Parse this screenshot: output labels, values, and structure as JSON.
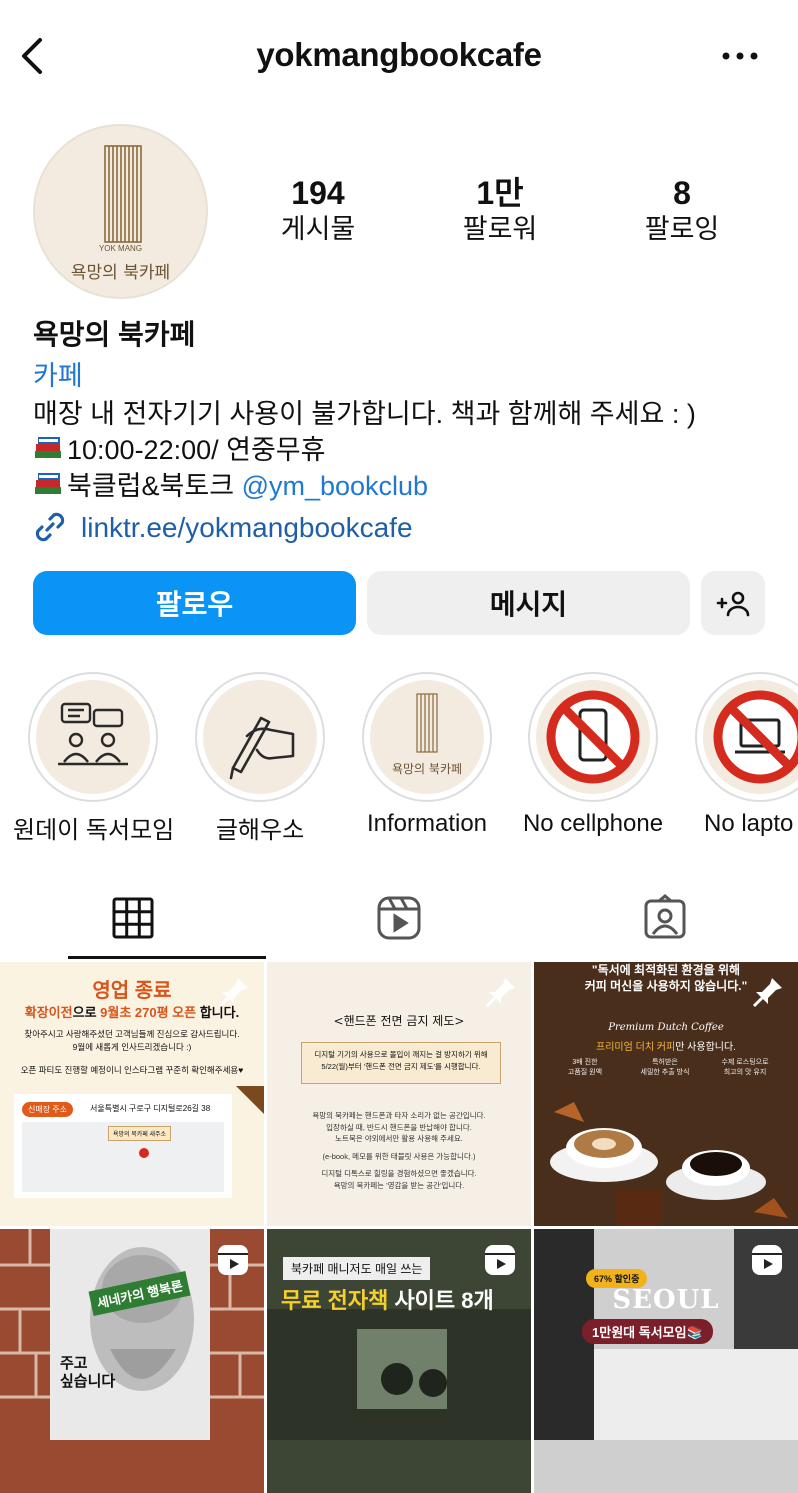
{
  "header": {
    "username": "yokmangbookcafe",
    "back_icon": "back-arrow-icon",
    "more_icon": "more-options-icon"
  },
  "profile": {
    "avatar_label": "욕망의 북카페",
    "avatar_small": "YOK MANG",
    "stats": [
      {
        "value": "194",
        "label": "게시물"
      },
      {
        "value": "1만",
        "label": "팔로워"
      },
      {
        "value": "8",
        "label": "팔로잉"
      }
    ],
    "name": "욕망의 북카페",
    "category": "카페",
    "bio_line1": "매장 내 전자기기 사용이 불가합니다. 책과 함께해 주세요 : )",
    "bio_line2": "10:00-22:00/ 연중무휴",
    "bio_line3": "북클럽&북토크 ",
    "bio_mention": "@ym_bookclub",
    "link": "linktr.ee/yokmangbookcafe"
  },
  "buttons": {
    "follow": "팔로우",
    "message": "메시지",
    "add_icon": "add-person-icon"
  },
  "highlights": [
    {
      "label": "원데이 독서모임",
      "icon": "meeting-icon"
    },
    {
      "label": "글해우소",
      "icon": "writing-hand-icon"
    },
    {
      "label": "Information",
      "icon": "logo-icon"
    },
    {
      "label": "No cellphone",
      "icon": "no-phone-icon"
    },
    {
      "label": "No lapto",
      "icon": "no-laptop-icon"
    }
  ],
  "tabs": [
    {
      "icon": "grid-icon"
    },
    {
      "icon": "reels-icon"
    },
    {
      "icon": "tagged-icon"
    }
  ],
  "posts": {
    "p1": {
      "title": "영업 종료",
      "sub_a": "확장이전",
      "sub_b": "으로 ",
      "sub_c": "9월초 270평 오픈",
      "sub_d": " 합니다.",
      "body1": "찾아주시고 사랑해주셨던 고객님들께 진심으로 감사드립니다.",
      "body2": "9월에 새롭게 인사드리겠습니다 :)",
      "body3": "오픈 파티도 진행할 예정이니 인스타그램 꾸준히 확인해주세용♥",
      "addr_tag": "신매장 주소",
      "addr": "서울특별시 구로구 디지털로26길 38",
      "map_tag": "욕망의 북카페 새주소"
    },
    "p2": {
      "title": "<핸드폰 전면 금지 제도>",
      "b1": "디지털 기기의 사용으로 몰입이 깨지는 걸 방지하기 위해",
      "b2": "5/22(월)부터 '핸드폰 전면 금지 제도'를 시행합니다.",
      "c1": "욕망의 북카페는 핸드폰과 타자 소리가 없는 공간입니다.",
      "c2": "입장하실 때, 반드시 핸드폰을 반납해야 합니다.",
      "c3": "노트북은 야외에서만 활용 사용해 주세요.",
      "c4": "(e-book, 메모를 위한 태블릿 사용은 가능합니다.)",
      "c5": "디지털 디톡스로 힐링을 경험하셨으면 좋겠습니다.",
      "c6": "욕망의 북카페는 '영감을 받는 공간'입니다."
    },
    "p3": {
      "t1": "\"독서에 최적화된 환경을 위해",
      "t2": "커피 머신을 사용하지 않습니다.\"",
      "en": "Premium Dutch Coffee",
      "k1": "프리미엄",
      "k2": " 더치 커피",
      "k3": "만 사용합니다.",
      "f1a": "3배 진한",
      "f1b": "고품질 원액",
      "f2a": "특허받은",
      "f2b": "세밀한 추출 방식",
      "f3a": "수제 로스팅으로",
      "f3b": "최고의 맛 유지"
    },
    "p4": {
      "tag": "세네카의 행복론",
      "l1": "주고",
      "l2": "싶습니다"
    },
    "p5": {
      "tag": "북카페 매니저도 매일 쓰는",
      "t1": "무료 전자책",
      "t2": " 사이트 8개"
    },
    "p6": {
      "badge": "67% 할인중",
      "city": "SEOUL",
      "sub": "1만원대 독서모임📚"
    }
  },
  "colors": {
    "accent": "#0a95f6",
    "link": "#1f78d1",
    "red": "#d52b1e"
  }
}
